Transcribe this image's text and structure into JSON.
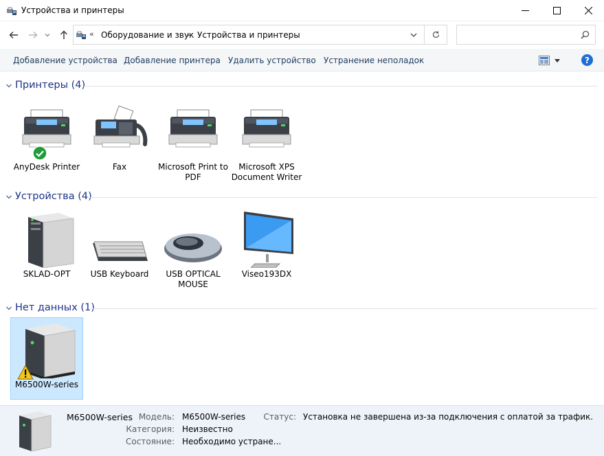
{
  "window": {
    "title": "Устройства и принтеры"
  },
  "address": {
    "overflow": "«",
    "crumbs": [
      "Оборудование и звук",
      "Устройства и принтеры"
    ],
    "search_placeholder": ""
  },
  "toolbar": {
    "add_device": "Добавление устройства",
    "add_printer": "Добавление принтера",
    "remove_device": "Удалить устройство",
    "troubleshoot": "Устранение неполадок",
    "help": "?"
  },
  "groups": {
    "printers": {
      "title": "Принтеры (4)",
      "items": [
        {
          "label": "AnyDesk Printer",
          "icon": "printer-icon",
          "default": true
        },
        {
          "label": "Fax",
          "icon": "fax-icon"
        },
        {
          "label": "Microsoft Print to PDF",
          "icon": "printer-icon"
        },
        {
          "label": "Microsoft XPS Document Writer",
          "icon": "printer-icon"
        }
      ]
    },
    "devices": {
      "title": "Устройства (4)",
      "items": [
        {
          "label": "SKLAD-OPT",
          "icon": "computer-tower-icon"
        },
        {
          "label": "USB Keyboard",
          "icon": "keyboard-icon"
        },
        {
          "label": "USB OPTICAL MOUSE",
          "icon": "mouse-icon"
        },
        {
          "label": "Viseo193DX",
          "icon": "monitor-icon"
        }
      ]
    },
    "nodata": {
      "title": "Нет данных (1)",
      "items": [
        {
          "label": "M6500W-series",
          "icon": "device-box-icon",
          "warning": true,
          "selected": true
        }
      ]
    }
  },
  "details": {
    "name": "M6500W-series",
    "model_key": "Модель:",
    "model_val": "M6500W-series",
    "category_key": "Категория:",
    "category_val": "Неизвестно",
    "state_key": "Состояние:",
    "state_val": "Необходимо устране...",
    "status_key": "Статус:",
    "status_val": "Установка не завершена из-за подключения с оплатой за трафик."
  },
  "colors": {
    "group_title": "#1e3287",
    "selection_bg": "#cce8ff",
    "detail_bg": "#eef3fa",
    "help_blue": "#1c6fd6",
    "ok_green": "#1e9d3a",
    "warn_yellow": "#f5c518"
  }
}
